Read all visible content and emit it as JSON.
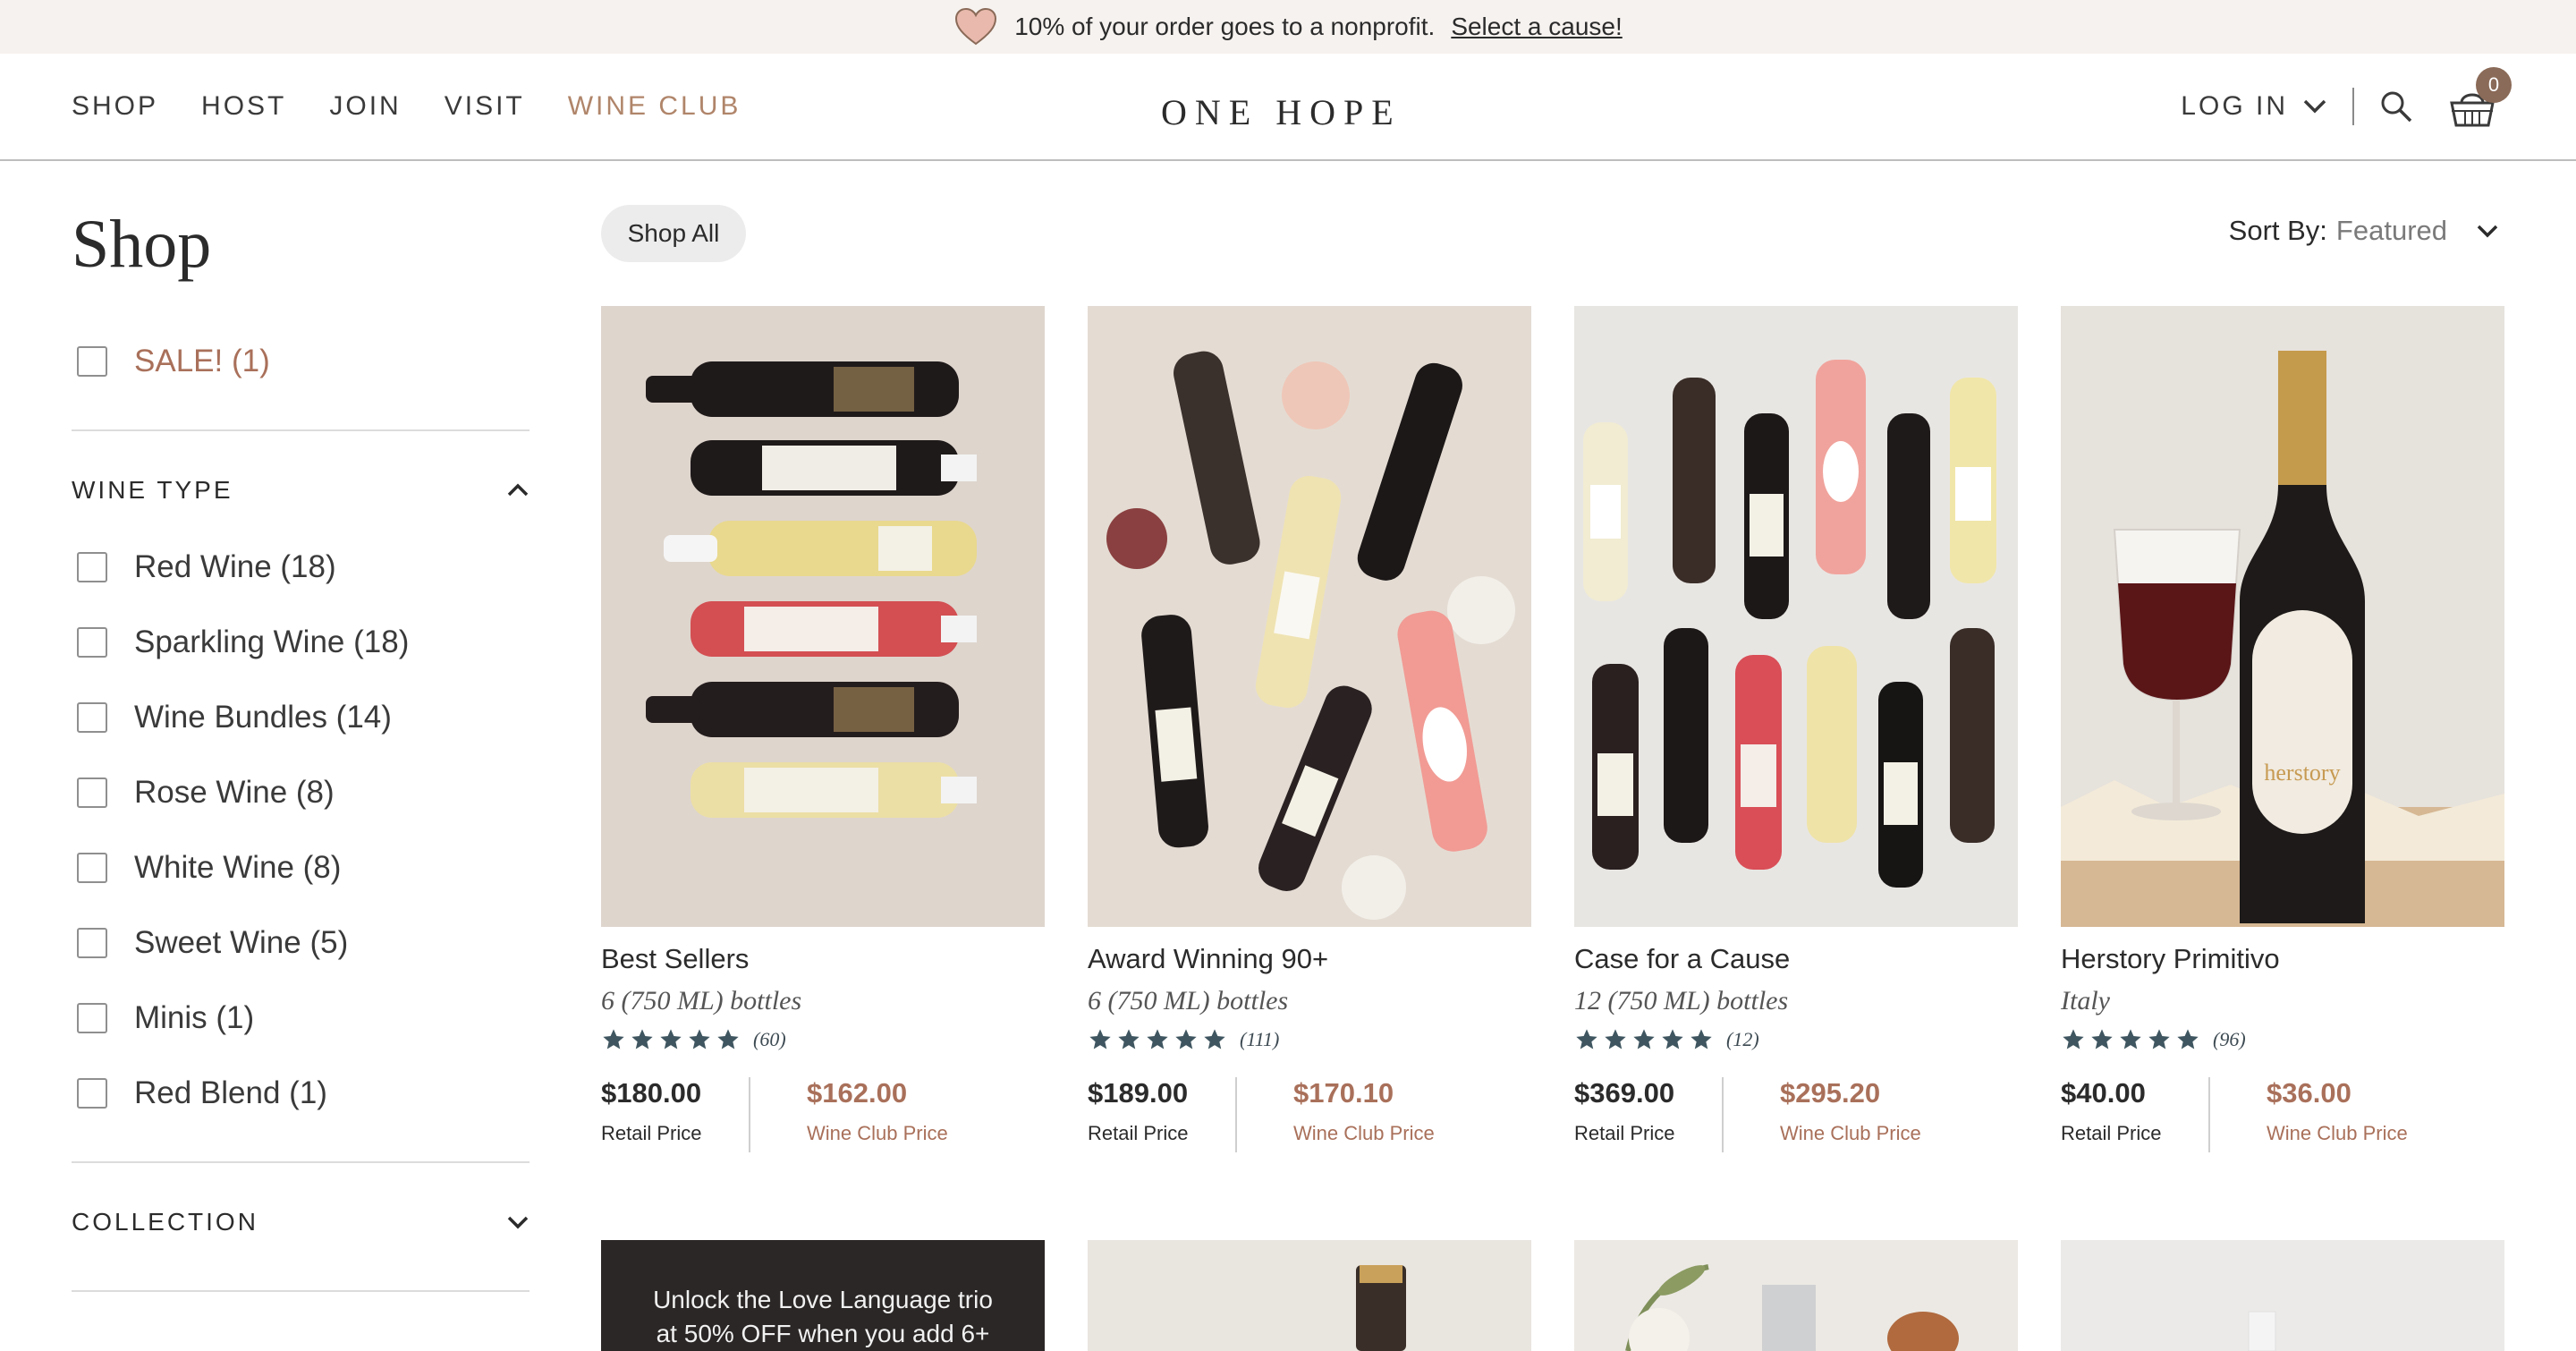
{
  "announcement": {
    "text": "10% of your order goes to a nonprofit.",
    "link": "Select a cause!"
  },
  "nav": {
    "items": [
      "SHOP",
      "HOST",
      "JOIN",
      "VISIT",
      "WINE CLUB"
    ],
    "logo": "ONE HOPE",
    "login": "LOG IN",
    "cart_count": "0"
  },
  "sidebar": {
    "title": "Shop",
    "sale": "SALE! (1)",
    "wine_type_label": "WINE TYPE",
    "wine_types": [
      "Red Wine (18)",
      "Sparkling Wine (18)",
      "Wine Bundles (14)",
      "Rose Wine (8)",
      "White Wine (8)",
      "Sweet Wine (5)",
      "Minis (1)",
      "Red Blend (1)"
    ],
    "collection_label": "COLLECTION"
  },
  "toolbar": {
    "shop_all": "Shop All",
    "sort_label": "Sort By:",
    "sort_value": "Featured"
  },
  "products": [
    {
      "name": "Best Sellers",
      "sub": "6 (750 ML) bottles",
      "rating": 5,
      "reviews": "(60)",
      "retail": "$180.00",
      "retail_label": "Retail Price",
      "club": "$162.00",
      "club_label": "Wine Club Price"
    },
    {
      "name": "Award Winning 90+",
      "sub": "6 (750 ML) bottles",
      "rating": 5,
      "reviews": "(111)",
      "retail": "$189.00",
      "retail_label": "Retail Price",
      "club": "$170.10",
      "club_label": "Wine Club Price"
    },
    {
      "name": "Case for a Cause",
      "sub": "12 (750 ML) bottles",
      "rating": 5,
      "reviews": "(12)",
      "retail": "$369.00",
      "retail_label": "Retail Price",
      "club": "$295.20",
      "club_label": "Wine Club Price"
    },
    {
      "name": "Herstory Primitivo",
      "sub": "Italy",
      "rating": 5,
      "reviews": "(96)",
      "retail": "$40.00",
      "retail_label": "Retail Price",
      "club": "$36.00",
      "club_label": "Wine Club Price"
    }
  ],
  "promo": {
    "line1": "Unlock the Love Language trio",
    "line2": "at 50% OFF when you add 6+"
  },
  "colors": {
    "accent": "#b0856a",
    "price_accent": "#a9705a",
    "star": "#3f5660",
    "announcement_bg": "#f6f2ef"
  },
  "icons": [
    "heart-icon",
    "chevron-down-icon",
    "search-icon",
    "cart-icon",
    "chevron-up-icon",
    "star-icon"
  ]
}
